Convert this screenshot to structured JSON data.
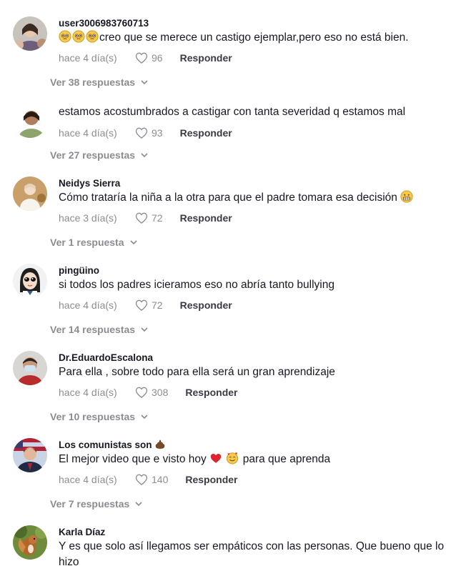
{
  "meta_labels": {
    "reply": "Responder"
  },
  "colors": {
    "text": "#161823",
    "muted": "rgba(22,24,35,0.5)",
    "heart_outline": "#8a8b91"
  },
  "comments": [
    {
      "username": "user3006983760713",
      "text": "creo que se merece un castigo ejemplar,pero eso no está bien.",
      "emojis": [
        "pleading-face",
        "pleading-face",
        "pleading-face"
      ],
      "time": "hace 4 día(s)",
      "likes": "96",
      "replies": "Ver 38 respuestas"
    },
    {
      "username": "",
      "text": "estamos acostumbrados a castigar con tanta severidad q estamos mal",
      "time": "hace 4 día(s)",
      "likes": "93",
      "replies": "Ver 27 respuestas"
    },
    {
      "username": "Neidys Sierra",
      "text": "Cómo trataría la niña a la otra para que el padre tomara esa decisión",
      "trailing_emoji": "grimacing-face",
      "time": "hace 3 día(s)",
      "likes": "72",
      "replies": "Ver 1 respuesta"
    },
    {
      "username": "pingüino",
      "text": "si todos los padres icieramos eso no abría tanto bullying",
      "time": "hace 4 día(s)",
      "likes": "72",
      "replies": "Ver 14 respuestas"
    },
    {
      "username": "Dr.EduardoEscalona",
      "text": "Para ella , sobre todo para ella será un gran aprendizaje",
      "time": "hace 4 día(s)",
      "likes": "308",
      "replies": "Ver 10 respuestas"
    },
    {
      "username": "Los comunistas son",
      "username_emoji": "poop",
      "text_before": "El mejor video que e visto hoy",
      "text_after": "para que aprenda",
      "inline_emojis": [
        "red-heart",
        "smiling-face-with-hearts"
      ],
      "time": "hace 4 día(s)",
      "likes": "140",
      "replies": "Ver 7 respuestas"
    },
    {
      "username": "Karla Díaz",
      "text": "Y es que solo así llegamos ser empáticos con las personas. Que bueno que lo hizo"
    }
  ]
}
